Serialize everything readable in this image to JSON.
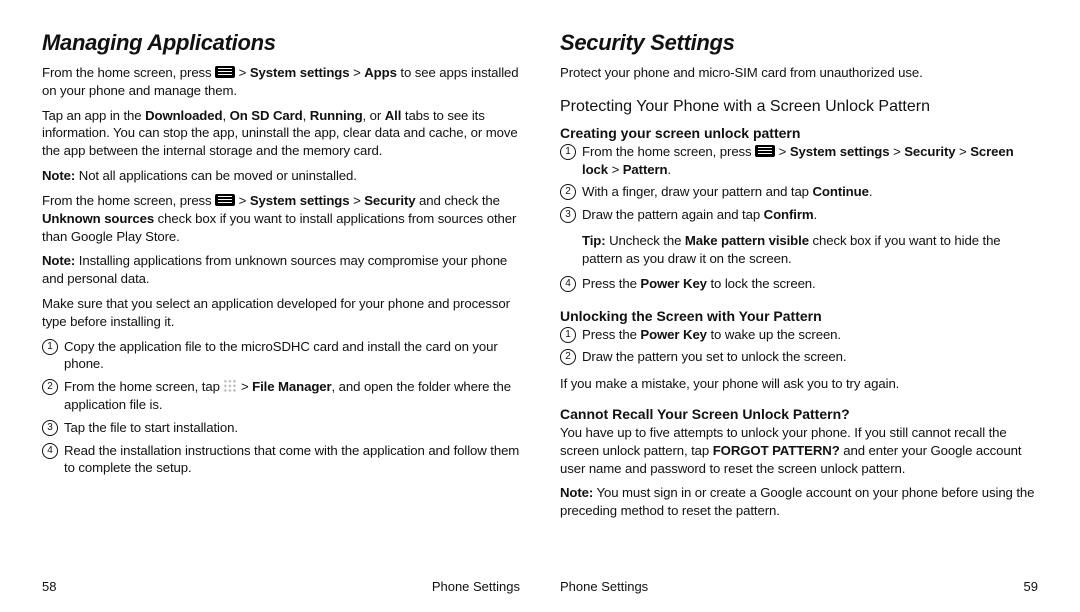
{
  "left": {
    "title": "Managing Applications",
    "p1_a": "From the home screen, press ",
    "p1_b": " > ",
    "p1_sys": "System settings",
    "p1_c": " > ",
    "p1_apps": "Apps",
    "p1_d": " to see apps installed on your phone and manage them.",
    "p2_a": "Tap an app in the ",
    "p2_dl": "Downloaded",
    "p2_b": ", ",
    "p2_sd": "On SD Card",
    "p2_c": ", ",
    "p2_run": "Running",
    "p2_d": ", or ",
    "p2_all": "All",
    "p2_e": " tabs to see its information. You can stop the app, uninstall the app, clear data and cache, or move the app between the internal storage and the memory card.",
    "p3_note": "Note:",
    "p3_text": " Not all applications can be moved or uninstalled.",
    "p4_a": "From the home screen, press ",
    "p4_b": " > ",
    "p4_sys": "System settings",
    "p4_c": " > ",
    "p4_sec": "Security",
    "p4_d": " and check the ",
    "p4_unk": "Unknown sources",
    "p4_e": " check box if you want to install applications from sources other than Google Play Store.",
    "p5_note": "Note:",
    "p5_text": " Installing applications from unknown sources may compromise your phone and personal data.",
    "p6": "Make sure that you select an application developed for your phone and processor type before installing it.",
    "li1": "Copy the application file to the microSDHC card and install the card on your phone.",
    "li2_a": "From the home screen, tap ",
    "li2_b": " > ",
    "li2_fm": "File Manager",
    "li2_c": ", and open the folder where the application file is.",
    "li3": "Tap the file to start installation.",
    "li4": "Read the installation instructions that come with the application and follow them to complete the setup.",
    "footer_page": "58",
    "footer_label": "Phone Settings"
  },
  "right": {
    "title": "Security Settings",
    "intro": "Protect your phone and micro-SIM card from unauthorized use.",
    "h2": "Protecting Your Phone with a Screen Unlock Pattern",
    "h3a": "Creating your screen unlock pattern",
    "a1_a": "From the home screen, press ",
    "a1_b": " > ",
    "a1_sys": "System settings",
    "a1_c": " > ",
    "a1_sec": "Security",
    "a1_d": " > ",
    "a1_lock": "Screen lock",
    "a1_e": " > ",
    "a1_pat": "Pattern",
    "a1_f": ".",
    "a2_a": "With a finger, draw your pattern and tap ",
    "a2_cont": "Continue",
    "a2_b": ".",
    "a3_a": "Draw the pattern again and tap ",
    "a3_conf": "Confirm",
    "a3_b": ".",
    "tip_label": "Tip:",
    "tip_a": " Uncheck the ",
    "tip_mpv": "Make pattern visible",
    "tip_b": " check box if you want to hide the pattern as you draw it on the screen.",
    "a4_a": "Press the ",
    "a4_pk": "Power Key",
    "a4_b": " to lock the screen.",
    "h3b": "Unlocking the Screen with Your Pattern",
    "b1_a": "Press the ",
    "b1_pk": "Power Key",
    "b1_b": " to wake up the screen.",
    "b2": "Draw the pattern you set to unlock the screen.",
    "unlock_note": "If you make a mistake, your phone will ask you to try again.",
    "h3c": "Cannot Recall Your Screen Unlock Pattern?",
    "c1_a": "You have up to five attempts to unlock your phone. If you still cannot recall the screen unlock pattern, tap ",
    "c1_fp": "FORGOT PATTERN?",
    "c1_b": " and enter your Google account user name and password to reset the screen unlock pattern.",
    "c2_note": "Note:",
    "c2_text": " You must sign in or create a Google account on your phone before using the preceding method to reset the pattern.",
    "footer_label": "Phone Settings",
    "footer_page": "59"
  }
}
